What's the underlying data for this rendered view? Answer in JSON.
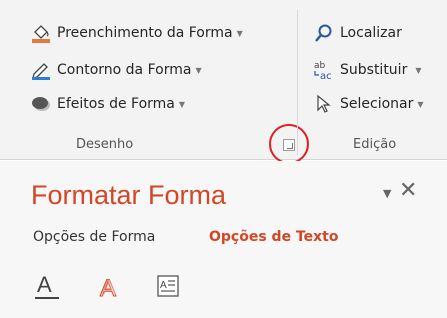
{
  "ribbon": {
    "desenho": {
      "fill_label": "Preenchimento da Forma",
      "outline_label": "Contorno da Forma",
      "effects_label": "Efeitos de Forma",
      "group_label": "Desenho"
    },
    "edicao": {
      "find_label": "Localizar",
      "replace_label": "Substituir",
      "select_label": "Selecionar",
      "group_label": "Edição"
    }
  },
  "pane": {
    "title": "Formatar Forma",
    "tabs": {
      "shape_options": "Opções de Forma",
      "text_options": "Opções de Texto"
    },
    "icons": [
      "text-fill-outline-icon",
      "text-effects-icon",
      "textbox-icon"
    ]
  },
  "colors": {
    "accent": "#d24726",
    "highlight": "#e01f1f"
  }
}
